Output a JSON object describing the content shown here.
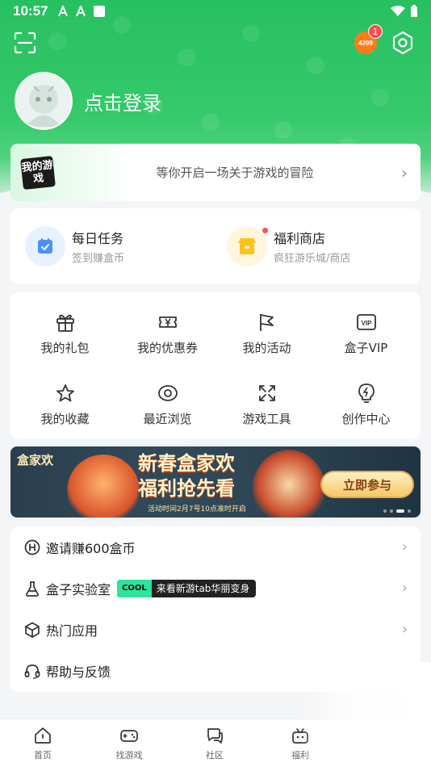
{
  "status_bar": {
    "time": "10:57"
  },
  "header": {
    "badge_count": "1",
    "logo_text": "4399"
  },
  "profile": {
    "login_label": "点击登录"
  },
  "adventure": {
    "logo_text": "我的游戏",
    "text": "等你开启一场关于游戏的冒险"
  },
  "tasks": [
    {
      "title": "每日任务",
      "subtitle": "签到赚盒币",
      "icon": "calendar-check-icon",
      "color": "#4a90ff"
    },
    {
      "title": "福利商店",
      "subtitle": "疯狂游乐城/商店",
      "icon": "shop-icon",
      "color": "#ffc21a"
    }
  ],
  "grid": [
    {
      "label": "我的礼包",
      "icon": "gift-icon"
    },
    {
      "label": "我的优惠券",
      "icon": "coupon-icon"
    },
    {
      "label": "我的活动",
      "icon": "flag-icon"
    },
    {
      "label": "盒子VIP",
      "icon": "vip-icon"
    },
    {
      "label": "我的收藏",
      "icon": "star-icon"
    },
    {
      "label": "最近浏览",
      "icon": "eye-icon"
    },
    {
      "label": "游戏工具",
      "icon": "tools-icon"
    },
    {
      "label": "创作中心",
      "icon": "lightbulb-icon"
    }
  ],
  "banner": {
    "brand": "盒家欢",
    "title_line1": "新春盒家欢",
    "title_line2": "福利抢先看",
    "date_text": "活动时间2月7号10点准时开启",
    "button": "立即参与"
  },
  "menu": [
    {
      "label": "邀请赚600盒币",
      "icon": "invite-coin-icon",
      "chevron": "›"
    },
    {
      "label": "盒子实验室",
      "icon": "flask-icon",
      "chevron": "›",
      "tag_badge": "COOL",
      "tag_text": "来看新游tab华丽变身"
    },
    {
      "label": "热门应用",
      "icon": "cube-icon",
      "chevron": "›"
    },
    {
      "label": "帮助与反馈",
      "icon": "headset-icon"
    }
  ],
  "tabbar": [
    {
      "label": "首页",
      "icon": "home-icon"
    },
    {
      "label": "找游戏",
      "icon": "gamepad-icon"
    },
    {
      "label": "社区",
      "icon": "chat-icon"
    },
    {
      "label": "福利",
      "icon": "gift-box-icon"
    }
  ]
}
